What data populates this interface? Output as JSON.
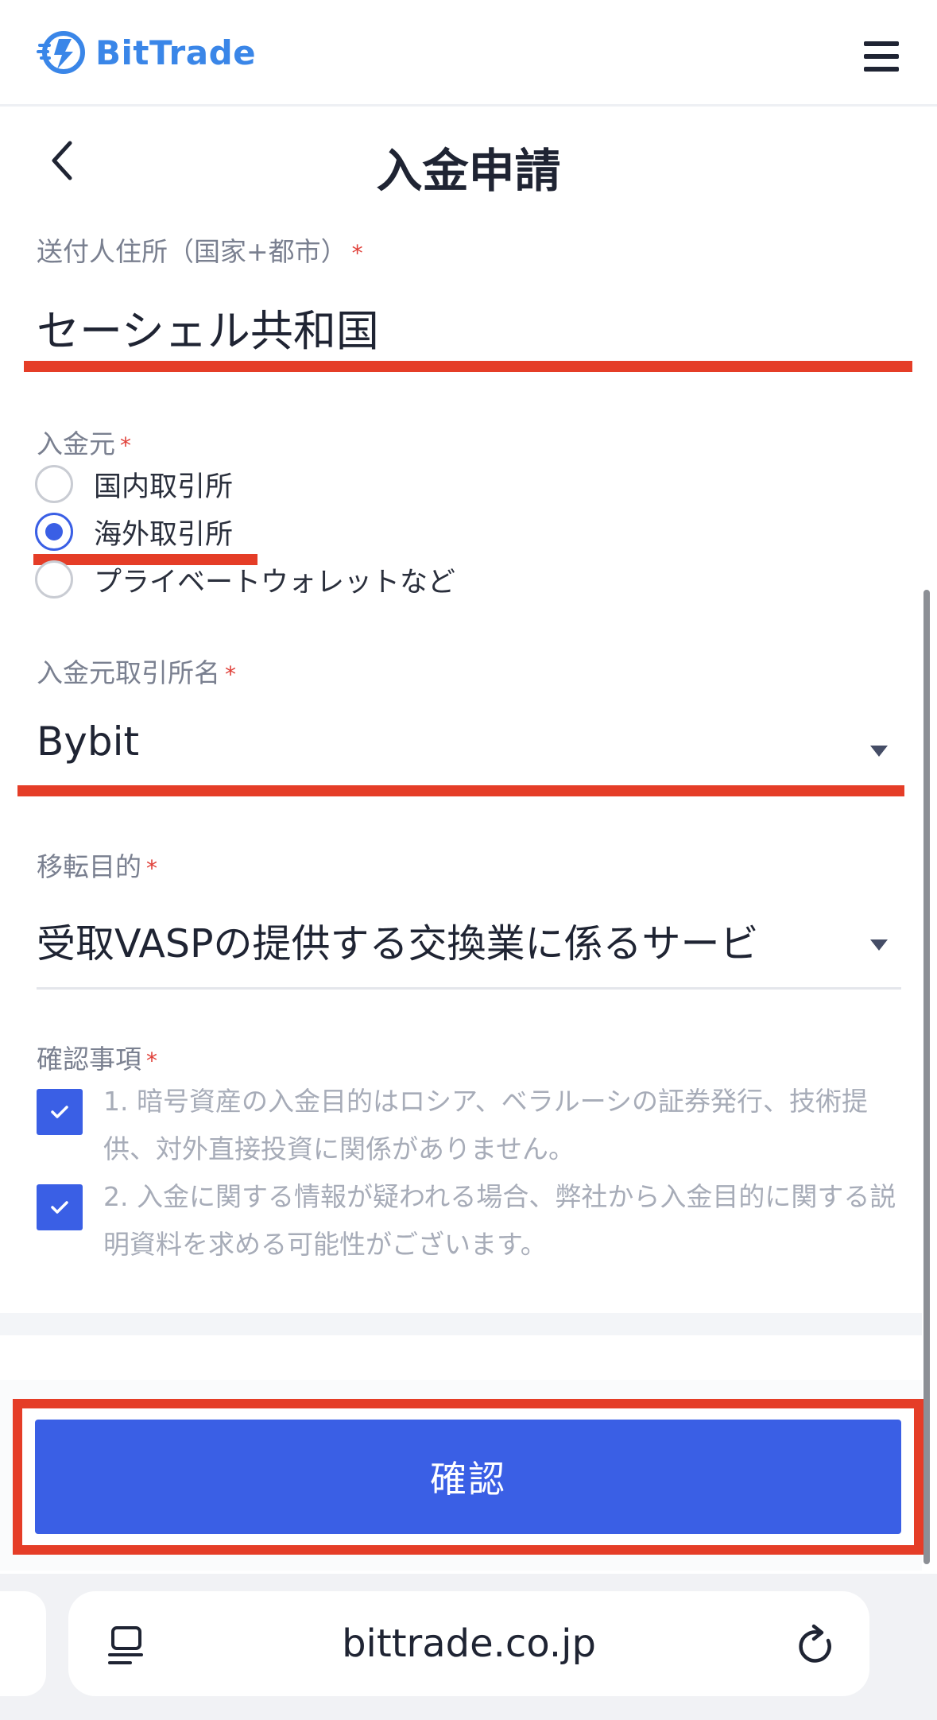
{
  "header": {
    "brand": "BitTrade",
    "logo_icon": "bittrade-logo-icon",
    "menu_icon": "hamburger-menu-icon"
  },
  "page": {
    "title": "入金申請",
    "back_icon": "chevron-left-icon"
  },
  "form": {
    "sender_address": {
      "label": "送付人住所（国家+都市）",
      "required_mark": "*",
      "value": "セーシェル共和国"
    },
    "source": {
      "label": "入金元",
      "required_mark": "*",
      "options": [
        {
          "label": "国内取引所",
          "checked": false
        },
        {
          "label": "海外取引所",
          "checked": true
        },
        {
          "label": "プライベートウォレットなど",
          "checked": false
        }
      ]
    },
    "exchange_name": {
      "label": "入金元取引所名",
      "required_mark": "*",
      "value": "Bybit"
    },
    "purpose": {
      "label": "移転目的",
      "required_mark": "*",
      "value": "受取VASPの提供する交換業に係るサービ"
    },
    "confirmations": {
      "label": "確認事項",
      "required_mark": "*",
      "items": [
        {
          "text": "1. 暗号資産の入金目的はロシア、ベラルーシの証券発行、技術提供、対外直接投資に関係がありません。",
          "checked": true
        },
        {
          "text": "2. 入金に関する情報が疑われる場合、弊社から入金目的に関する説明資料を求める可能性がございます。",
          "checked": true
        }
      ]
    },
    "submit_label": "確認"
  },
  "colors": {
    "accent": "#3a5fe5",
    "brand": "#3a86e8",
    "highlight_red": "#e53d27"
  },
  "browser": {
    "url": "bittrade.co.jp",
    "tabs_icon": "tab-overview-icon",
    "reload_icon": "reload-icon"
  }
}
